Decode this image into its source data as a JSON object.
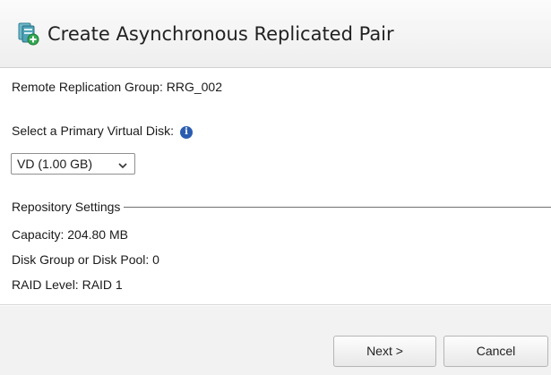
{
  "dialog": {
    "title": "Create Asynchronous Replicated Pair",
    "title_icon": "replicated-pair-add-icon"
  },
  "content": {
    "remote_group": "Remote Replication Group: RRG_002",
    "primary_disk_label": "Select a Primary Virtual Disk:",
    "info_icon": "info-icon",
    "info_glyph": "i",
    "primary_disk_selected": "VD (1.00 GB)"
  },
  "repository": {
    "header": "Repository Settings",
    "capacity": "Capacity: 204.80 MB",
    "disk_group": "Disk Group or Disk Pool: 0",
    "raid_level": "RAID Level: RAID 1"
  },
  "footer": {
    "next_label": "Next >",
    "cancel_label": "Cancel"
  },
  "colors": {
    "icon_teal": "#3a9ab0",
    "icon_green": "#34a853",
    "info_blue": "#2a5db0"
  }
}
